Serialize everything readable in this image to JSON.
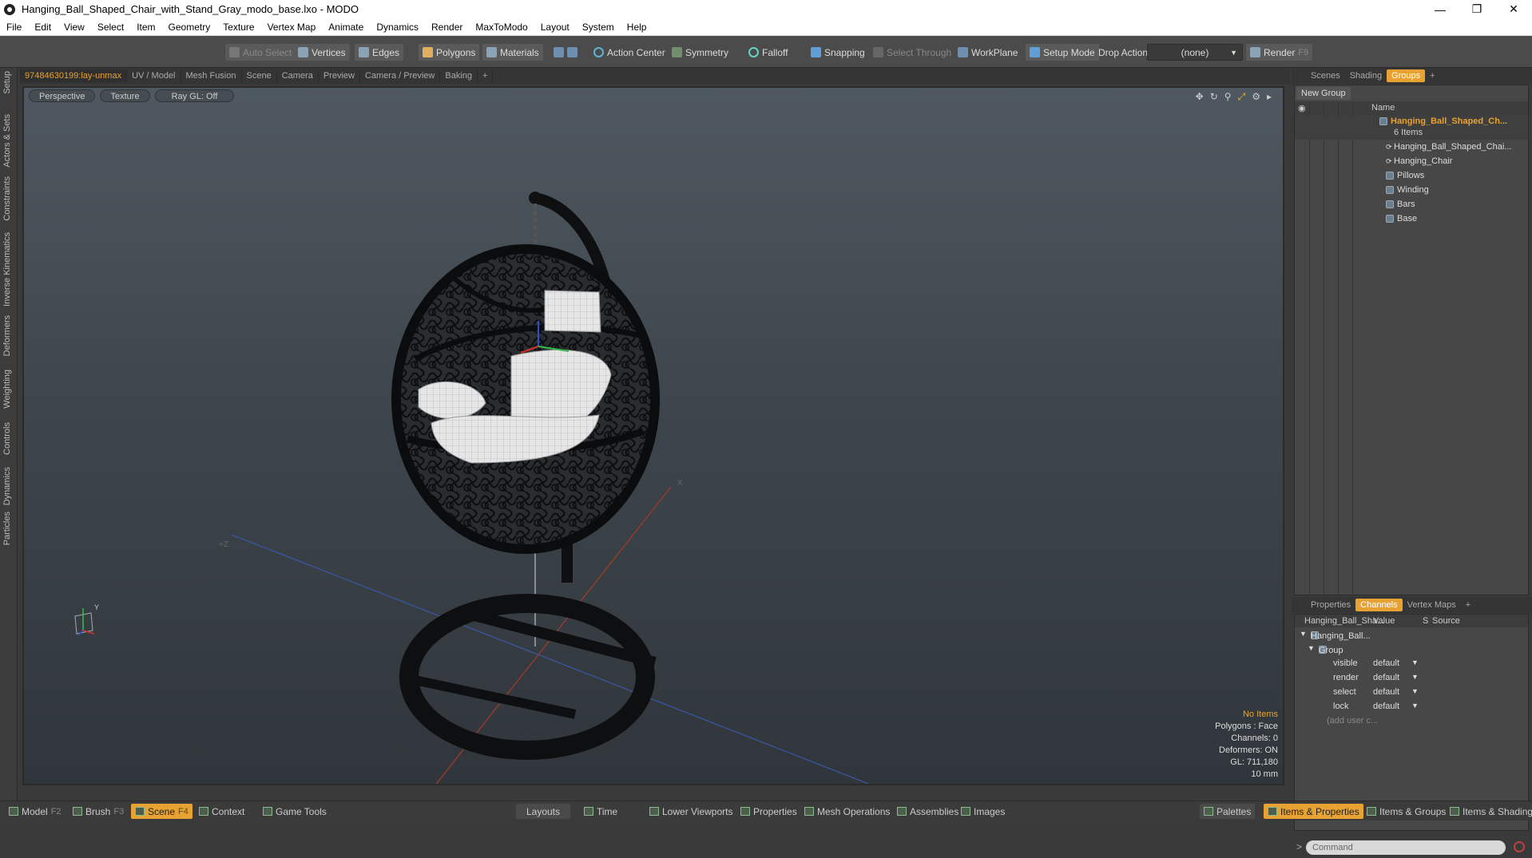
{
  "window": {
    "title": "Hanging_Ball_Shaped_Chair_with_Stand_Gray_modo_base.lxo - MODO"
  },
  "menu": [
    "File",
    "Edit",
    "View",
    "Select",
    "Item",
    "Geometry",
    "Texture",
    "Vertex Map",
    "Animate",
    "Dynamics",
    "Render",
    "MaxToModo",
    "Layout",
    "System",
    "Help"
  ],
  "toolbar": {
    "auto_select": "Auto Select",
    "vertices": "Vertices",
    "edges": "Edges",
    "polygons": "Polygons",
    "materials": "Materials",
    "action_center": "Action Center",
    "symmetry": "Symmetry",
    "falloff": "Falloff",
    "snapping": "Snapping",
    "select_through": "Select Through",
    "workplane": "WorkPlane",
    "setup_mode": "Setup Mode",
    "drop_action": "Drop Action",
    "drop_value": "(none)",
    "render": "Render",
    "render_key": "F9"
  },
  "left_tabs": [
    "Setup",
    "Actors & Sets",
    "Constraints",
    "Inverse Kinematics",
    "Deformers",
    "Weighting",
    "Controls",
    "Dynamics",
    "Particles"
  ],
  "viewport_tabs": [
    "97484630199:lay-unmax",
    "UV / Model",
    "Mesh Fusion",
    "Scene",
    "Camera",
    "Preview",
    "Camera / Preview",
    "Baking",
    "+"
  ],
  "viewport": {
    "perspective": "Perspective",
    "texture": "Texture",
    "raygl": "Ray GL: Off",
    "axis_x": "X",
    "axis_z": "+Z",
    "gizmo_y": "Y",
    "info": {
      "items": "No Items",
      "polygons": "Polygons : Face",
      "channels": "Channels: 0",
      "deformers": "Deformers: ON",
      "gl": "GL: 711,180",
      "scale": "10 mm"
    }
  },
  "groups_panel": {
    "tabs": [
      "Scenes",
      "Shading",
      "Groups",
      "+"
    ],
    "new_group": "New Group",
    "name_header": "Name",
    "group_name": "Hanging_Ball_Shaped_Ch...",
    "group_count": "6 Items",
    "items": [
      "Hanging_Ball_Shaped_Chai...",
      "Hanging_Chair",
      "Pillows",
      "Winding",
      "Bars",
      "Base"
    ]
  },
  "channels_panel": {
    "tabs": [
      "Properties",
      "Channels",
      "Vertex Maps",
      "+"
    ],
    "headers": {
      "name": "Hanging_Ball_Sha...",
      "value": "Value",
      "s": "S",
      "source": "Source"
    },
    "item": "Hanging_Ball...",
    "group": "Group",
    "rows": [
      {
        "name": "visible",
        "value": "default"
      },
      {
        "name": "render",
        "value": "default"
      },
      {
        "name": "select",
        "value": "default"
      },
      {
        "name": "lock",
        "value": "default"
      }
    ],
    "add_user": "(add user c..."
  },
  "command": {
    "placeholder": "Command"
  },
  "bottom": {
    "model": "Model",
    "model_key": "F2",
    "brush": "Brush",
    "brush_key": "F3",
    "scene": "Scene",
    "scene_key": "F4",
    "context": "Context",
    "game_tools": "Game Tools",
    "layouts": "Layouts",
    "time": "Time",
    "lower_viewports": "Lower Viewports",
    "properties": "Properties",
    "mesh_operations": "Mesh Operations",
    "assemblies": "Assemblies",
    "images": "Images",
    "palettes": "Palettes",
    "items_properties": "Items & Properties",
    "items_groups": "Items & Groups",
    "items_shading": "Items & Shading"
  },
  "colors": {
    "accent": "#e8a232",
    "viewport_top": "#4f5860",
    "viewport_bottom": "#30363b"
  }
}
